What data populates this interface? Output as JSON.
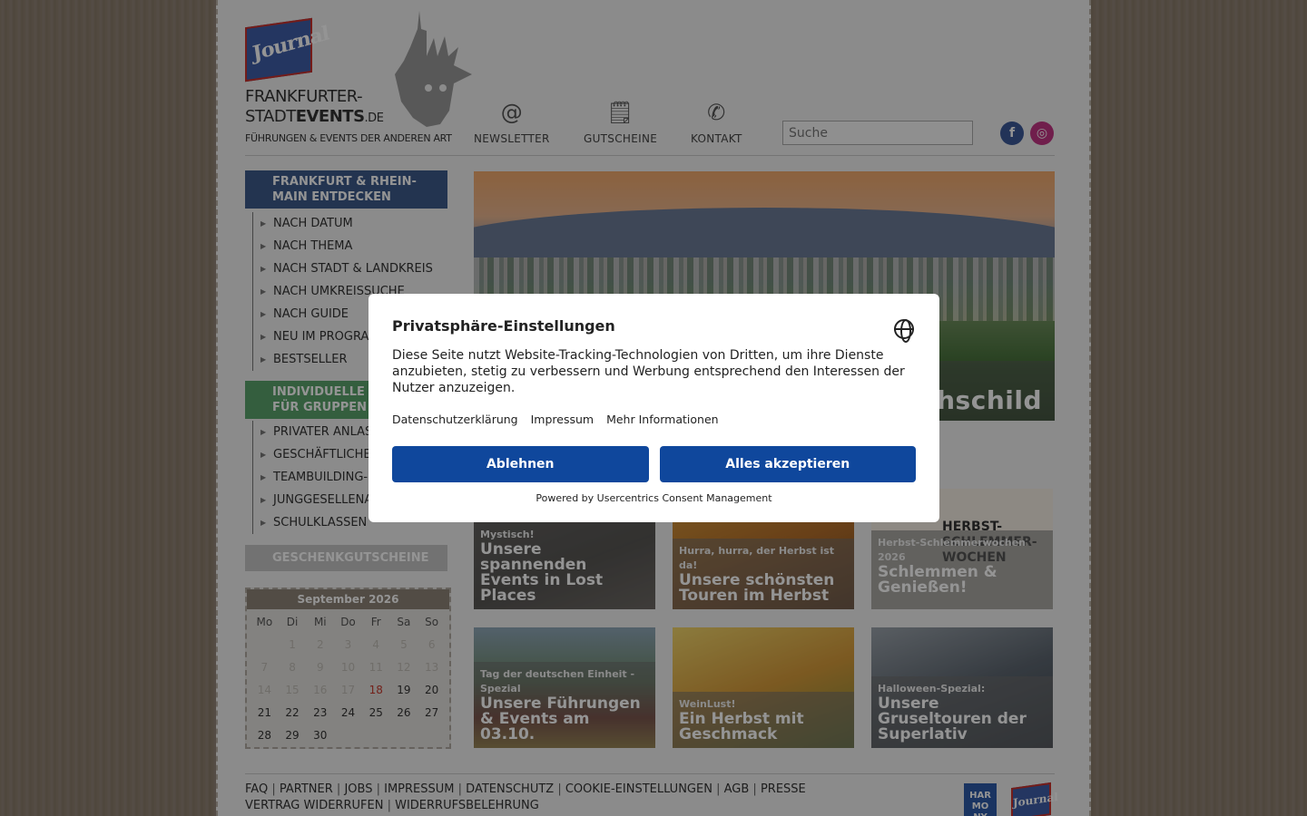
{
  "header": {
    "logo_journal": "Journal",
    "logo_line1": "FRANKFURTER-",
    "logo_line2_a": "STADT",
    "logo_line2_b": "EVENTS",
    "logo_line2_c": ".DE",
    "tagline": "FÜHRUNGEN & EVENTS DER ANDEREN ART",
    "nav": [
      {
        "label": "NEWSLETTER",
        "icon": "at-icon"
      },
      {
        "label": "GUTSCHEINE",
        "icon": "voucher-icon"
      },
      {
        "label": "KONTAKT",
        "icon": "phone-icon"
      }
    ],
    "search_placeholder": "Suche",
    "social": [
      {
        "name": "facebook-icon",
        "glyph": "f",
        "color": "#3b5998"
      },
      {
        "name": "instagram-icon",
        "glyph": "◎",
        "color": "#c13584"
      }
    ]
  },
  "sidebar": {
    "section1": {
      "title": "FRANKFURT & RHEIN-MAIN ENTDECKEN",
      "color": "#3d5a8a",
      "items": [
        "NACH DATUM",
        "NACH THEMA",
        "NACH STADT & LANDKREIS",
        "NACH UMKREISSUCHE",
        "NACH GUIDE",
        "NEU IM PROGRAMM",
        "BESTSELLER"
      ]
    },
    "section2": {
      "title": "INDIVIDUELLE EVENTS FÜR GRUPPEN",
      "color": "#5aa36b",
      "items": [
        "PRIVATER ANLASS",
        "GESCHÄFTLICHER ANLASS",
        "TEAMBUILDING-EVENTS",
        "JUNGGESELLENABSCHIED",
        "SCHULKLASSEN"
      ]
    },
    "section3": {
      "title": "GESCHENKGUTSCHEINE",
      "color": "#c5c5c5"
    }
  },
  "calendar": {
    "title": "September 2026",
    "weekdays": [
      "Mo",
      "Di",
      "Mi",
      "Do",
      "Fr",
      "Sa",
      "So"
    ],
    "rows": [
      [
        "",
        "1",
        "2",
        "3",
        "4",
        "5",
        "6"
      ],
      [
        "7",
        "8",
        "9",
        "10",
        "11",
        "12",
        "13"
      ],
      [
        "14",
        "15",
        "16",
        "17",
        "18",
        "19",
        "20"
      ],
      [
        "21",
        "22",
        "23",
        "24",
        "25",
        "26",
        "27"
      ],
      [
        "28",
        "29",
        "30",
        "",
        "",
        "",
        ""
      ]
    ],
    "today": "18"
  },
  "hero": {
    "caption": "Rothschild"
  },
  "tiles": [
    {
      "kicker": "Mystisch!",
      "headline": "Unsere spannenden Events in Lost Places"
    },
    {
      "kicker": "Hurra, hurra, der Herbst ist da!",
      "headline": "Unsere schönsten Touren im Herbst"
    },
    {
      "kicker": "Herbst-Schlemmerwochen 2026",
      "headline": "Schlemmen & Genießen!"
    },
    {
      "kicker": "Tag der deutschen Einheit - Spezial",
      "headline": "Unsere Führungen & Events am 03.10."
    },
    {
      "kicker": "WeinLust!",
      "headline": "Ein Herbst mit Geschmack"
    },
    {
      "kicker": "Halloween-Spezial:",
      "headline": "Unsere Gruseltouren der Superlativ"
    }
  ],
  "tile3_badge": "HERBST-SCHLEMMER-WOCHEN",
  "footer": {
    "row1": [
      "FAQ",
      "PARTNER",
      "JOBS",
      "IMPRESSUM",
      "DATENSCHUTZ",
      "COOKIE-EINSTELLUNGEN",
      "AGB",
      "PRESSE"
    ],
    "row2": [
      "VERTRAG WIDERRUFEN",
      "WIDERRUFSBELEHRUNG"
    ],
    "badge_harmony": "HAR MO NY",
    "badge_journal": "Journal"
  },
  "consent": {
    "title": "Privatsphäre-Einstellungen",
    "text": "Diese Seite nutzt Website-Tracking-Technologien von Dritten, um ihre Dienste anzubieten, stetig zu verbessern und Werbung entsprechend den Interessen der Nutzer anzuzeigen.",
    "links": [
      "Datenschutzerklärung",
      "Impressum",
      "Mehr Informationen"
    ],
    "deny": "Ablehnen",
    "accept": "Alles akzeptieren",
    "powered": "Powered by Usercentrics Consent Management"
  }
}
